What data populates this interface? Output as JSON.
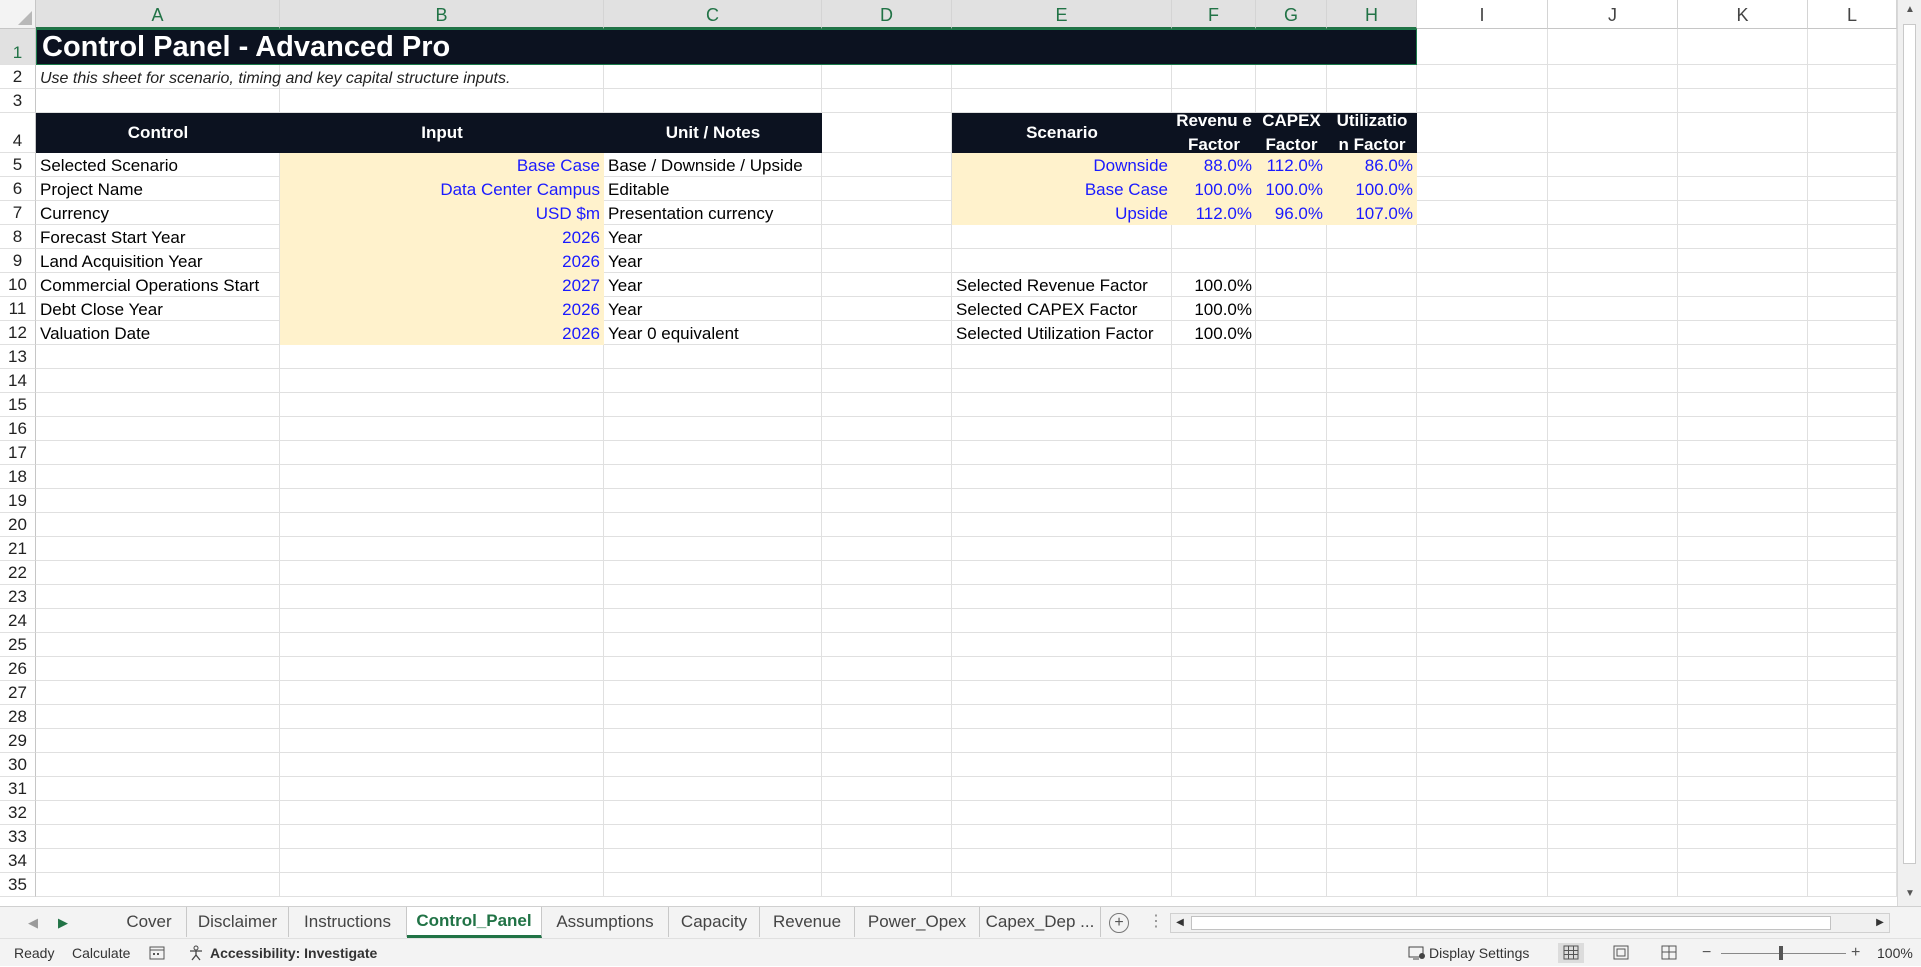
{
  "columns": [
    "A",
    "B",
    "C",
    "D",
    "E",
    "F",
    "G",
    "H",
    "I",
    "J",
    "K",
    "L"
  ],
  "rows": [
    "1",
    "2",
    "3",
    "4",
    "5",
    "6",
    "7",
    "8",
    "9",
    "10",
    "11",
    "12",
    "13",
    "14",
    "15",
    "16",
    "17",
    "18",
    "19",
    "20",
    "21",
    "22",
    "23",
    "24",
    "25",
    "26",
    "27",
    "28",
    "29",
    "30",
    "31",
    "32",
    "33",
    "34",
    "35"
  ],
  "sheet": {
    "title": "Control Panel - Advanced Pro",
    "subtitle": "Use this sheet for scenario, timing and key capital structure inputs.",
    "left_headers": [
      "Control",
      "Input",
      "Unit / Notes"
    ],
    "left_rows": [
      {
        "control": "Selected Scenario",
        "input": "Base Case",
        "note": "Base / Downside / Upside"
      },
      {
        "control": "Project Name",
        "input": "Data Center Campus",
        "note": "Editable"
      },
      {
        "control": "Currency",
        "input": "USD $m",
        "note": "Presentation currency"
      },
      {
        "control": "Forecast Start Year",
        "input": "2026",
        "note": "Year"
      },
      {
        "control": "Land Acquisition Year",
        "input": "2026",
        "note": "Year"
      },
      {
        "control": "Commercial Operations Start",
        "input": "2027",
        "note": "Year"
      },
      {
        "control": "Debt Close Year",
        "input": "2026",
        "note": "Year"
      },
      {
        "control": "Valuation Date",
        "input": "2026",
        "note": "Year 0 equivalent"
      }
    ],
    "right_headers": [
      "Scenario",
      "Revenu e Factor",
      "CAPEX Factor",
      "Utilizatio n Factor"
    ],
    "scenarios": [
      {
        "name": "Downside",
        "revenue": "88.0%",
        "capex": "112.0%",
        "util": "86.0%"
      },
      {
        "name": "Base Case",
        "revenue": "100.0%",
        "capex": "100.0%",
        "util": "100.0%"
      },
      {
        "name": "Upside",
        "revenue": "112.0%",
        "capex": "96.0%",
        "util": "107.0%"
      }
    ],
    "selected": [
      {
        "label": "Selected Revenue Factor",
        "value": "100.0%"
      },
      {
        "label": "Selected CAPEX Factor",
        "value": "100.0%"
      },
      {
        "label": "Selected Utilization Factor",
        "value": "100.0%"
      }
    ]
  },
  "tabs": [
    "Cover",
    "Disclaimer",
    "Instructions",
    "Control_Panel",
    "Assumptions",
    "Capacity",
    "Revenue",
    "Power_Opex",
    "Capex_Dep ..."
  ],
  "active_tab": "Control_Panel",
  "status": {
    "ready": "Ready",
    "calculate": "Calculate",
    "accessibility": "Accessibility: Investigate",
    "display_settings": "Display Settings",
    "zoom": "100%"
  },
  "colors": {
    "accent": "#217346",
    "header_bg": "#0c1220",
    "input_bg": "#fff2cc",
    "input_text": "#1a1aff"
  }
}
